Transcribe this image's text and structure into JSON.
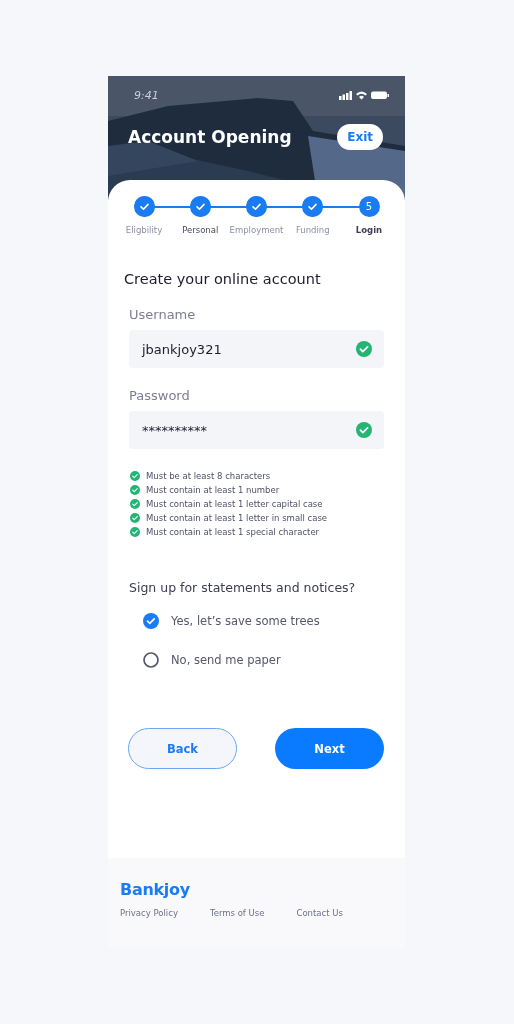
{
  "status_bar": {
    "time": "9:41"
  },
  "header": {
    "title": "Account Opening",
    "exit_button": "Exit"
  },
  "steps": [
    {
      "label": "Eligbility",
      "done": true,
      "selected": false
    },
    {
      "label": "Personal",
      "done": true,
      "selected": false
    },
    {
      "label": "Employment",
      "done": true,
      "selected": false
    },
    {
      "label": "Funding",
      "done": true,
      "selected": false
    },
    {
      "label": "Login",
      "done": false,
      "selected": true,
      "number": "5"
    }
  ],
  "heading": "Create your online account",
  "fields": [
    {
      "label": "Username",
      "value": "jbankjoy321",
      "valid": true
    },
    {
      "label": "Password",
      "value": "**********",
      "valid": true
    }
  ],
  "password_rules": [
    {
      "text": "Must be at least 8 characters",
      "met": true
    },
    {
      "text": "Must contain at least 1 number",
      "met": true
    },
    {
      "text": "Must contain at least 1 letter capital case",
      "met": true
    },
    {
      "text": "Must contain at least 1 letter in small case",
      "met": true
    },
    {
      "text": "Must contain at least 1 special character",
      "met": true
    }
  ],
  "statements": {
    "question": "Sign up for statements and notices?",
    "options": [
      {
        "label": "Yes, let’s save some trees",
        "selected": true
      },
      {
        "label": "No, send me paper",
        "selected": false
      }
    ]
  },
  "buttons": [
    {
      "label": "Back",
      "kind": "secondary"
    },
    {
      "label": "Next",
      "kind": "primary"
    }
  ],
  "footer": {
    "logo": "Bankjoy",
    "links": [
      "Privacy Policy",
      "Terms of Use",
      "Contact Us"
    ]
  }
}
